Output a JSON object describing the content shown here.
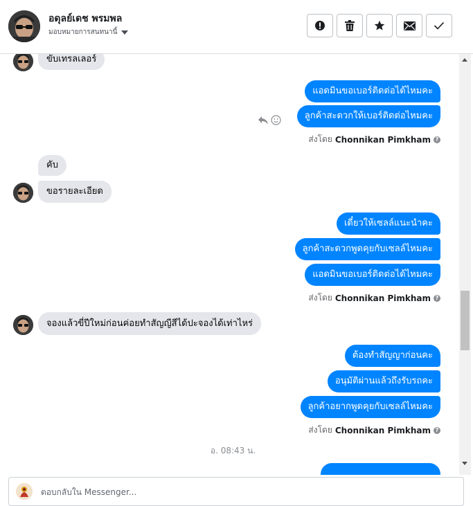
{
  "header": {
    "contact_name": "อดุลย์เดช พรมพล",
    "assign_label": "มอบหมายการสนทนานี้",
    "actions": [
      {
        "name": "report-spam-button",
        "icon": "alert-icon"
      },
      {
        "name": "delete-button",
        "icon": "trash-icon"
      },
      {
        "name": "star-button",
        "icon": "star-icon"
      },
      {
        "name": "mark-unread-button",
        "icon": "envelope-icon"
      },
      {
        "name": "mark-done-button",
        "icon": "check-icon"
      }
    ]
  },
  "messages": {
    "in1": "ขับเทรลเลอร์",
    "out1": "แอดมินขอเบอร์ติดต่อได้ไหมคะ",
    "out2": "ลูกค้าสะดวกให้เบอร์ติดต่อไหมคะ",
    "sent_by_label": "ส่งโดย",
    "sender": "Chonnikan Pimkham",
    "in2": "คับ",
    "in3": "ขอรายละเอียด",
    "out3": "เดี๋ยวให้เซลล์แนะนำคะ",
    "out4": "ลูกค้าสะดวกพูดคุยกับเซลล์ไหมคะ",
    "out5": "แอดมินขอเบอร์ติดต่อได้ไหมคะ",
    "in4": "จองแล้วขี่ปีใหม่ก่อนค่อยทำสัญญีสีได้ปะจองได้เท่าไหร่",
    "out6": "ต้องทำสัญญาก่อนคะ",
    "out7": "อนุมัติผ่านแล้วถึงรับรถคะ",
    "out8": "ลูกค้าอยากพูดคุยกับเซลล์ไหมคะ",
    "timestamp": "อ. 08:43 น."
  },
  "composer": {
    "placeholder": "ตอบกลับใน Messenger..."
  },
  "colors": {
    "outgoing": "#0084ff",
    "incoming": "#e4e6eb"
  }
}
